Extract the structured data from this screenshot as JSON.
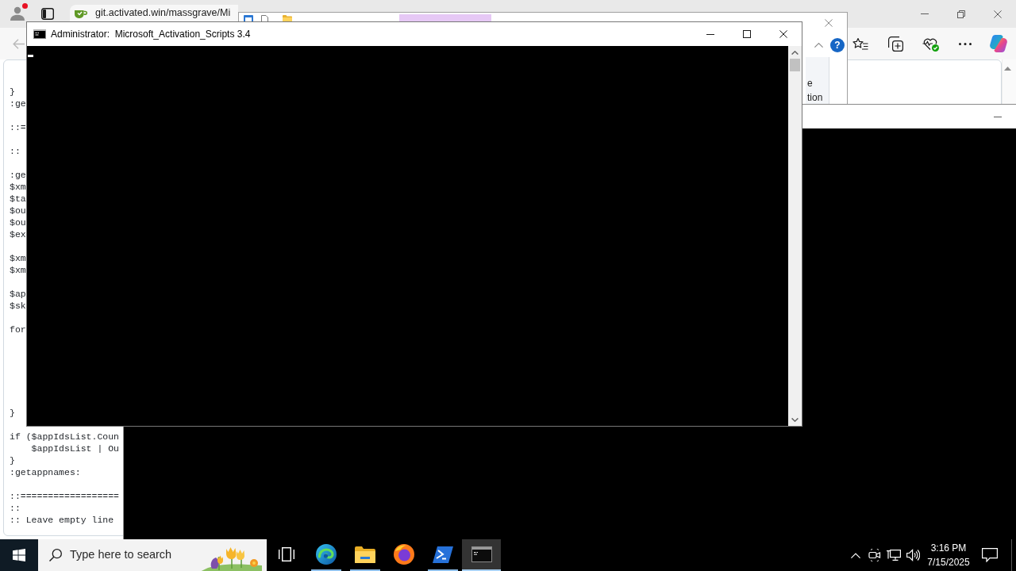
{
  "browser": {
    "profile": {
      "notification": true
    },
    "tab": {
      "title": "git.activated.win/massgrave/Mi"
    },
    "back": {
      "disabled": true
    },
    "code_blocks": [
      [
        "}",
        ":ge"
      ],
      [
        "::="
      ],
      [
        "::"
      ],
      [
        ":ge",
        "$xm",
        "$ta",
        "$ou",
        "$ou",
        "$ex"
      ],
      [
        "$xm",
        "$xm"
      ],
      [
        "$ap",
        "$sk"
      ],
      [
        "for"
      ],
      [
        "}"
      ],
      [
        "if ($appIdsList.Coun",
        "    $appIdsList | Ou",
        "}",
        ":getappnames:"
      ],
      [
        "::==================",
        "::",
        ":: Leave empty line"
      ]
    ]
  },
  "explorer": {
    "help": "?",
    "ribbon_texts": [
      "e",
      "tion"
    ]
  },
  "console": {
    "title": "Administrator:  Microsoft_Activation_Scripts 3.4"
  },
  "taskbar": {
    "search": {
      "placeholder": "Type here to search"
    },
    "apps": [
      {
        "kind": "taskview",
        "running": false,
        "selected": false
      },
      {
        "kind": "swirl",
        "running": true,
        "selected": false
      },
      {
        "kind": "folder",
        "running": true,
        "selected": false
      },
      {
        "kind": "globe",
        "running": false,
        "selected": false
      },
      {
        "kind": "shell",
        "running": true,
        "selected": false
      },
      {
        "kind": "console",
        "running": true,
        "selected": true
      }
    ],
    "clock": {
      "time": "3:16 PM",
      "date": "7/15/2025"
    }
  }
}
